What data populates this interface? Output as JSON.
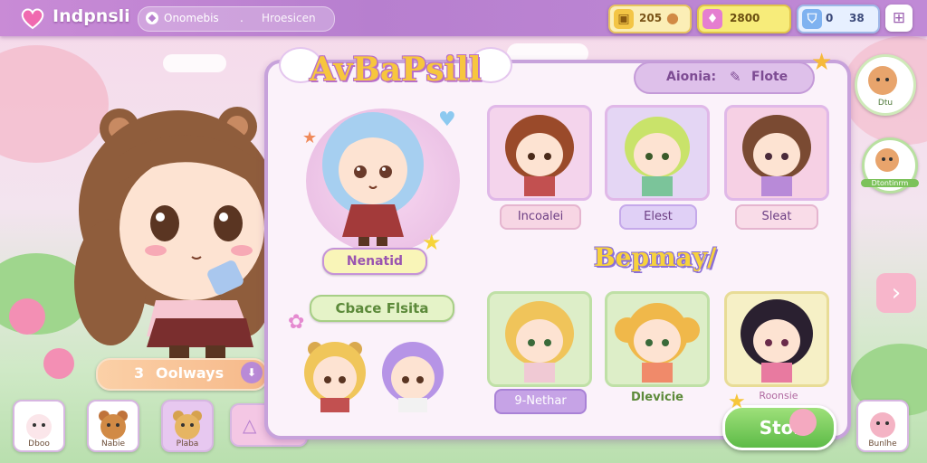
{
  "top_bar": {
    "title": "Indpnsli",
    "search_text": "Onomebis",
    "search_sep": ".",
    "search_hint": "Hroesicen",
    "currency_1": "205",
    "currency_2": "2800",
    "currency_3": "0",
    "currency_3b": "38"
  },
  "panel": {
    "title": "AvBaPsill",
    "tabs": [
      "Aionia:",
      "Flote"
    ],
    "featured_name": "Nenatid",
    "choose_label": "Cbace Flsita",
    "display_label": "Bepmay/",
    "start_button": "Stoi"
  },
  "cards_top": [
    {
      "label": "Incoalei"
    },
    {
      "label": "Elest"
    },
    {
      "label": "Sleat"
    }
  ],
  "cards_bottom": [
    {
      "label": "9-Nethar"
    },
    {
      "label": "Dlevicie"
    },
    {
      "label": "Roonsie"
    }
  ],
  "left": {
    "always_button": "Oolways",
    "always_num": "3"
  },
  "bottom_slots": [
    {
      "label": "Dboo"
    },
    {
      "label": "Nabie"
    },
    {
      "label": "Plaba"
    },
    {
      "label": ""
    }
  ],
  "right_side": {
    "top_label": "Dtu",
    "mid_label": "Dtontinrm",
    "bottom_label": "Bunlhe"
  },
  "colors": {
    "accent": "#b77fcf",
    "panel_bg": "#fbf2fa",
    "start_green": "#5dbb47",
    "gold": "#f7c63e"
  }
}
